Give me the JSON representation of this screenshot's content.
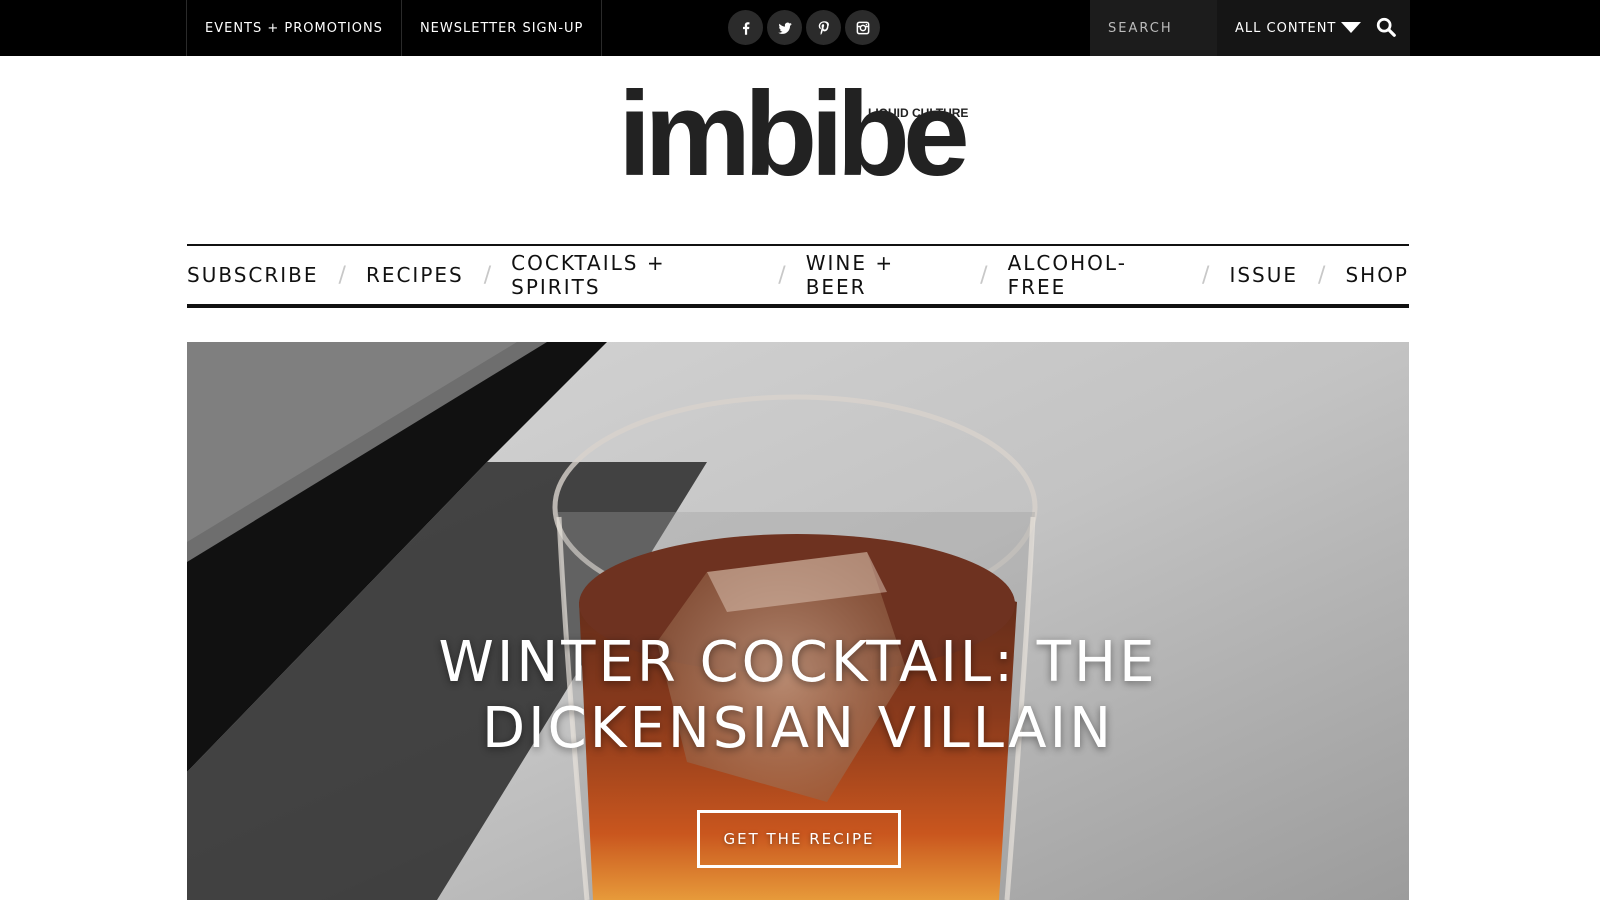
{
  "topbar": {
    "links": [
      "EVENTS + PROMOTIONS",
      "NEWSLETTER SIGN-UP"
    ],
    "social_icons": [
      "facebook-icon",
      "twitter-icon",
      "pinterest-icon",
      "instagram-icon"
    ],
    "search_placeholder": "SEARCH",
    "filter_value": "ALL CONTENT"
  },
  "logo": {
    "wordmark": "imbibe",
    "tagline": "LIQUID CULTURE"
  },
  "nav": {
    "items": [
      "SUBSCRIBE",
      "RECIPES",
      "COCKTAILS + SPIRITS",
      "WINE + BEER",
      "ALCOHOL-FREE",
      "ISSUE",
      "SHOP"
    ]
  },
  "hero": {
    "title_line1": "WINTER COCKTAIL: THE",
    "title_line2": "DICKENSIAN VILLAIN",
    "button_label": "GET THE RECIPE"
  },
  "colors": {
    "topbar_bg": "#000000",
    "accent": "#111111",
    "drink": "#b3471f"
  }
}
